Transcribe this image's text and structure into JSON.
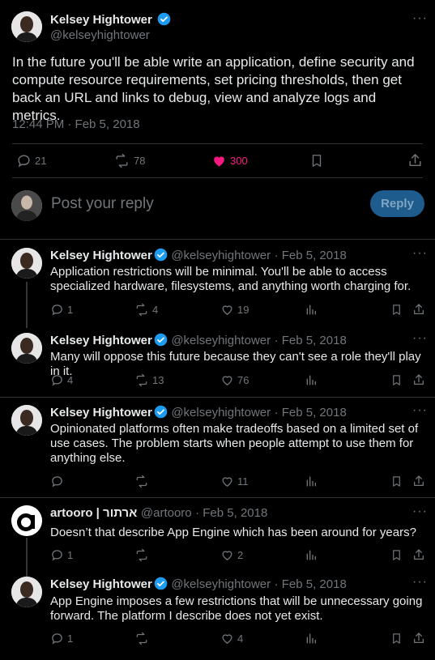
{
  "main_tweet": {
    "author_name": "Kelsey Hightower",
    "handle": "@kelseyhightower",
    "more": "···",
    "text": "In the future you'll be able write an application, define security and compute resource requirements, set pricing thresholds, then get back an URL and links to debug, view and analyze logs and metrics.",
    "timestamp": "12:44 PM · Feb 5, 2018",
    "replies": "21",
    "reposts": "78",
    "likes": "300",
    "like_color": "#f91880"
  },
  "composer": {
    "placeholder": "Post your reply",
    "button": "Reply"
  },
  "replies": [
    {
      "name": "Kelsey Hightower",
      "handle": "@kelseyhightower",
      "date": "· Feb 5, 2018",
      "text": "Application restrictions will be minimal. You'll be able to access specialized hardware, filesystems, and anything worth charging for.",
      "replies": "1",
      "reposts": "4",
      "likes": "19"
    },
    {
      "name": "Kelsey Hightower",
      "handle": "@kelseyhightower",
      "date": "· Feb 5, 2018",
      "text": "Many will oppose this future because they can't see a role they'll play in it.",
      "replies": "4",
      "reposts": "13",
      "likes": "76"
    },
    {
      "name": "Kelsey Hightower",
      "handle": "@kelseyhightower",
      "date": "· Feb 5, 2018",
      "text": "Opinionated platforms often make tradeoffs based on a limited set of use cases. The problem starts when people attempt to use them for anything else.",
      "replies": "",
      "reposts": "",
      "likes": "11"
    },
    {
      "name": "artooro | ארתור",
      "handle": "@artooro",
      "date": "· Feb 5, 2018",
      "text": "Doesn’t that describe App Engine which has been around for years?",
      "replies": "1",
      "reposts": "",
      "likes": "2"
    },
    {
      "name": "Kelsey Hightower",
      "handle": "@kelseyhightower",
      "date": "· Feb 5, 2018",
      "text": "App Engine imposes a few restrictions that will be unnecessary going forward. The platform I describe does not yet exist.",
      "replies": "1",
      "reposts": "",
      "likes": "4"
    }
  ],
  "colors": {
    "verified": "#1d9bf0",
    "muted": "#71767b",
    "divider": "#2f3336"
  }
}
